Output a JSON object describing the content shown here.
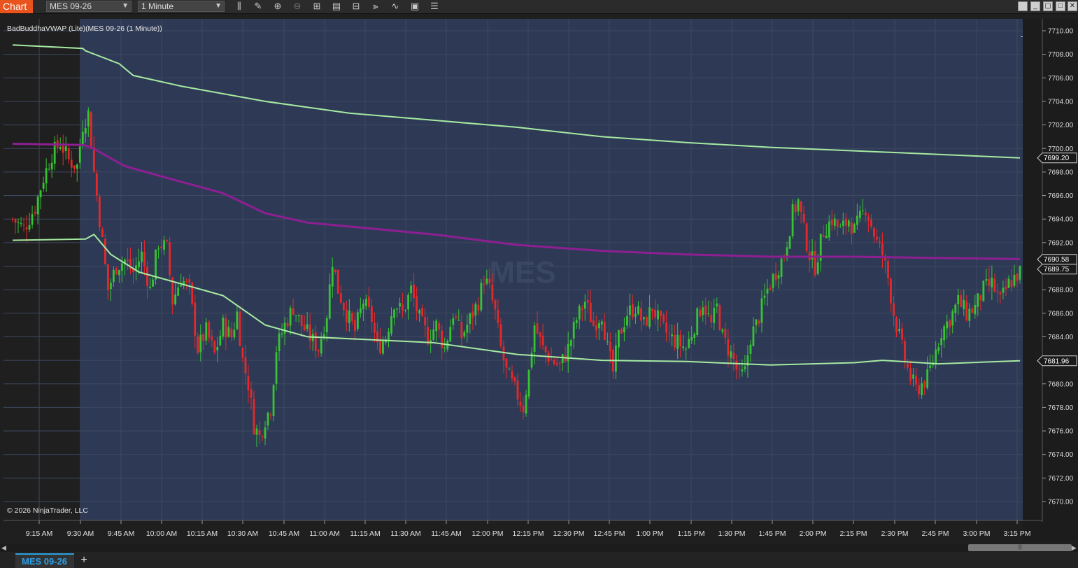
{
  "toolbar": {
    "chart_label": "Chart",
    "instrument": "MES 09-26",
    "interval": "1 Minute",
    "icons": [
      "bar-type-icon",
      "draw-pencil-icon",
      "zoom-in-icon",
      "zoom-out-icon",
      "crosshair-icon",
      "data-box-icon",
      "properties-icon",
      "chart-trader-icon",
      "strategy-icon",
      "indicators-icon",
      "templates-icon",
      "menu-icon"
    ]
  },
  "chart": {
    "indicator_label": "BadBuddhaVWAP (Lite)(MES 09-26 (1 Minute))",
    "watermark": "MES",
    "copyright": "© 2026 NinjaTrader, LLC",
    "arrow_label": "→",
    "colors": {
      "up": "#37c334",
      "down": "#e4292b",
      "upper_band": "#a6eaa2",
      "lower_band": "#a6eaa2",
      "vwap": "#8e1f93",
      "session_bg": "#2e3a55",
      "pre_bg": "#1f1f1f"
    }
  },
  "chart_data": {
    "type": "candlestick",
    "ylim": [
      7669,
      7711
    ],
    "y_ticks": [
      "7710.00",
      "7708.00",
      "7706.00",
      "7704.00",
      "7702.00",
      "7700.00",
      "7698.00",
      "7696.00",
      "7694.00",
      "7692.00",
      "7690.00",
      "7688.00",
      "7686.00",
      "7684.00",
      "7682.00",
      "7680.00",
      "7678.00",
      "7676.00",
      "7674.00",
      "7672.00",
      "7670.00"
    ],
    "x_ticks": [
      "9:15 AM",
      "9:30 AM",
      "9:45 AM",
      "10:00 AM",
      "10:15 AM",
      "10:30 AM",
      "10:45 AM",
      "11:00 AM",
      "11:15 AM",
      "11:30 AM",
      "11:45 AM",
      "12:00 PM",
      "12:15 PM",
      "12:30 PM",
      "12:45 PM",
      "1:00 PM",
      "1:15 PM",
      "1:30 PM",
      "1:45 PM",
      "2:00 PM",
      "2:15 PM",
      "2:30 PM",
      "2:45 PM",
      "3:00 PM",
      "3:15 PM"
    ],
    "price_markers": [
      {
        "label": "7699.20",
        "value": 7699.2
      },
      {
        "label": "7690.58",
        "value": 7690.58
      },
      {
        "label": "7689.75",
        "value": 7689.75
      },
      {
        "label": "7681.96",
        "value": 7681.96
      }
    ],
    "upper_band": [
      [
        0,
        7708.8
      ],
      [
        25,
        7708.5
      ],
      [
        26,
        7708.3
      ],
      [
        38,
        7707.2
      ],
      [
        43,
        7706.2
      ],
      [
        60,
        7705.3
      ],
      [
        90,
        7704.0
      ],
      [
        120,
        7703.0
      ],
      [
        150,
        7702.4
      ],
      [
        180,
        7701.8
      ],
      [
        210,
        7701.0
      ],
      [
        240,
        7700.5
      ],
      [
        270,
        7700.1
      ],
      [
        300,
        7699.8
      ],
      [
        330,
        7699.5
      ],
      [
        359,
        7699.2
      ]
    ],
    "vwap": [
      [
        0,
        7700.4
      ],
      [
        25,
        7700.3
      ],
      [
        28,
        7700.1
      ],
      [
        40,
        7698.5
      ],
      [
        55,
        7697.5
      ],
      [
        75,
        7696.2
      ],
      [
        90,
        7694.5
      ],
      [
        105,
        7693.7
      ],
      [
        150,
        7692.7
      ],
      [
        180,
        7691.8
      ],
      [
        210,
        7691.3
      ],
      [
        240,
        7691.0
      ],
      [
        270,
        7690.8
      ],
      [
        300,
        7690.8
      ],
      [
        330,
        7690.7
      ],
      [
        359,
        7690.6
      ]
    ],
    "lower_band": [
      [
        0,
        7692.2
      ],
      [
        26,
        7692.3
      ],
      [
        29,
        7692.7
      ],
      [
        35,
        7691.0
      ],
      [
        45,
        7689.5
      ],
      [
        60,
        7688.5
      ],
      [
        75,
        7687.5
      ],
      [
        90,
        7685.0
      ],
      [
        105,
        7684.0
      ],
      [
        150,
        7683.5
      ],
      [
        180,
        7682.5
      ],
      [
        210,
        7682.0
      ],
      [
        240,
        7681.9
      ],
      [
        270,
        7681.6
      ],
      [
        300,
        7681.8
      ],
      [
        310,
        7682.0
      ],
      [
        330,
        7681.7
      ],
      [
        359,
        7681.96
      ]
    ],
    "path": [
      [
        0,
        7694
      ],
      [
        4,
        7693.2
      ],
      [
        8,
        7695
      ],
      [
        11,
        7697.5
      ],
      [
        14,
        7699.5
      ],
      [
        17,
        7700.5
      ],
      [
        20,
        7699
      ],
      [
        23,
        7698.5
      ],
      [
        25,
        7702
      ],
      [
        27,
        7703
      ],
      [
        29,
        7698
      ],
      [
        31,
        7694
      ],
      [
        34,
        7688
      ],
      [
        37,
        7690
      ],
      [
        40,
        7690.5
      ],
      [
        43,
        7689.5
      ],
      [
        46,
        7691
      ],
      [
        49,
        7688
      ],
      [
        52,
        7692
      ],
      [
        55,
        7691.5
      ],
      [
        57,
        7687
      ],
      [
        60,
        7689
      ],
      [
        63,
        7688
      ],
      [
        66,
        7683
      ],
      [
        69,
        7684.5
      ],
      [
        72,
        7682.5
      ],
      [
        75,
        7685
      ],
      [
        78,
        7684
      ],
      [
        80,
        7686
      ],
      [
        82,
        7682
      ],
      [
        84,
        7680
      ],
      [
        86,
        7676.5
      ],
      [
        88,
        7675.5
      ],
      [
        90,
        7677
      ],
      [
        92,
        7678
      ],
      [
        94,
        7683
      ],
      [
        97,
        7685
      ],
      [
        100,
        7686.5
      ],
      [
        103,
        7685
      ],
      [
        106,
        7684
      ],
      [
        109,
        7683
      ],
      [
        112,
        7686
      ],
      [
        114,
        7690.5
      ],
      [
        116,
        7688
      ],
      [
        119,
        7686
      ],
      [
        122,
        7684.5
      ],
      [
        125,
        7687
      ],
      [
        128,
        7685.5
      ],
      [
        130,
        7683
      ],
      [
        133,
        7684
      ],
      [
        136,
        7687
      ],
      [
        139,
        7686
      ],
      [
        142,
        7688
      ],
      [
        145,
        7685.5
      ],
      [
        148,
        7684
      ],
      [
        151,
        7685
      ],
      [
        154,
        7683
      ],
      [
        157,
        7686
      ],
      [
        160,
        7684
      ],
      [
        163,
        7685.5
      ],
      [
        166,
        7687
      ],
      [
        168,
        7689
      ],
      [
        170,
        7688
      ],
      [
        172,
        7686
      ],
      [
        174,
        7683
      ],
      [
        176,
        7681
      ],
      [
        178,
        7680
      ],
      [
        180,
        7679
      ],
      [
        182,
        7678
      ],
      [
        184,
        7681
      ],
      [
        186,
        7685
      ],
      [
        189,
        7683
      ],
      [
        192,
        7682
      ],
      [
        195,
        7681.5
      ],
      [
        198,
        7683
      ],
      [
        201,
        7685.5
      ],
      [
        204,
        7687
      ],
      [
        207,
        7685
      ],
      [
        210,
        7686
      ],
      [
        212,
        7683
      ],
      [
        214,
        7681
      ],
      [
        216,
        7684
      ],
      [
        219,
        7686
      ],
      [
        222,
        7686.5
      ],
      [
        225,
        7685
      ],
      [
        228,
        7686.5
      ],
      [
        231,
        7685
      ],
      [
        234,
        7684
      ],
      [
        237,
        7683.5
      ],
      [
        240,
        7683
      ],
      [
        243,
        7685
      ],
      [
        246,
        7687
      ],
      [
        249,
        7685
      ],
      [
        251,
        7686.5
      ],
      [
        253,
        7684
      ],
      [
        255,
        7683
      ],
      [
        257,
        7682
      ],
      [
        259,
        7680.5
      ],
      [
        261,
        7681
      ],
      [
        263,
        7684
      ],
      [
        265,
        7685
      ],
      [
        267,
        7686.5
      ],
      [
        269,
        7688
      ],
      [
        272,
        7689.5
      ],
      [
        275,
        7691
      ],
      [
        278,
        7694.5
      ],
      [
        280,
        7695.5
      ],
      [
        282,
        7693
      ],
      [
        284,
        7691
      ],
      [
        286,
        7690
      ],
      [
        289,
        7693
      ],
      [
        292,
        7694
      ],
      [
        295,
        7693
      ],
      [
        298,
        7694
      ],
      [
        300,
        7693
      ],
      [
        302,
        7694
      ],
      [
        304,
        7695
      ],
      [
        306,
        7693.5
      ],
      [
        308,
        7692
      ],
      [
        310,
        7691
      ],
      [
        312,
        7689
      ],
      [
        314,
        7686
      ],
      [
        316,
        7684
      ],
      [
        318,
        7682
      ],
      [
        320,
        7680.5
      ],
      [
        322,
        7679.5
      ],
      [
        324,
        7680
      ],
      [
        326,
        7680.5
      ],
      [
        328,
        7682
      ],
      [
        331,
        7684.5
      ],
      [
        334,
        7685.5
      ],
      [
        337,
        7687
      ],
      [
        340,
        7686
      ],
      [
        343,
        7686.5
      ],
      [
        346,
        7688
      ],
      [
        349,
        7688.5
      ],
      [
        352,
        7687
      ],
      [
        355,
        7688.5
      ],
      [
        359,
        7689.5
      ]
    ]
  },
  "bottom": {
    "tab_label": "MES 09-26",
    "add_label": "+"
  }
}
